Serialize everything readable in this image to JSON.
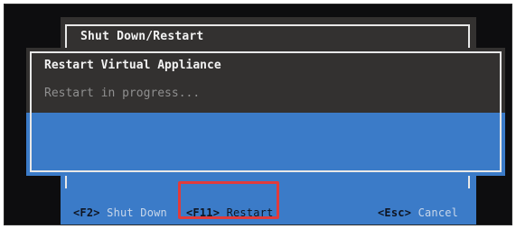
{
  "background_window": {
    "title": "Shut Down/Restart",
    "footer": {
      "shutdown_key": "<F2>",
      "shutdown_label": "Shut Down",
      "restart_key": "<F11>",
      "restart_label": "Restart",
      "cancel_key": "<Esc>",
      "cancel_label": "Cancel"
    }
  },
  "dialog": {
    "title": "Restart Virtual Appliance",
    "status": "Restart in progress..."
  },
  "colors": {
    "accent_blue": "#3b7bc8",
    "header_dark": "#333130",
    "highlight_red": "#e23b3b"
  }
}
